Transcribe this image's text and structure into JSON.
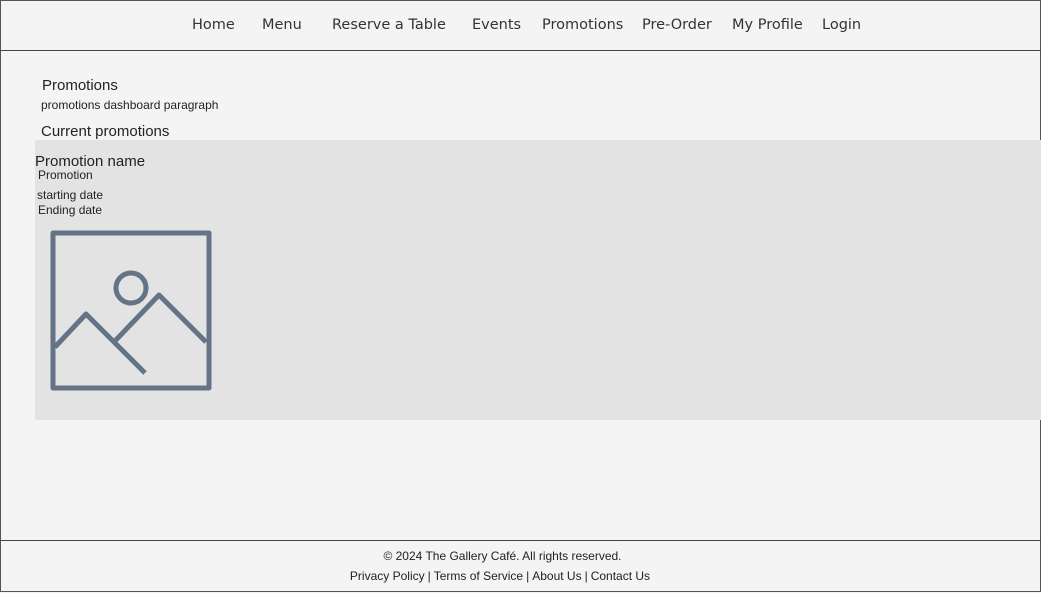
{
  "nav": {
    "items": [
      "Home",
      "Menu",
      "Reserve a Table",
      "Events",
      "Promotions",
      "Pre-Order",
      "My Profile",
      "Login"
    ]
  },
  "main": {
    "title": "Promotions",
    "description": "promotions dashboard paragraph",
    "section_title": "Current promotions",
    "promotion": {
      "name": "Promotion name",
      "detail": "Promotion",
      "start": "starting date",
      "end": "Ending date",
      "image_icon": "image-placeholder-icon"
    }
  },
  "footer": {
    "copyright": "© 2024 The Gallery Café. All rights reserved.",
    "links": [
      "Privacy Policy",
      "Terms of Service",
      "About Us",
      "Contact Us"
    ],
    "separator": "|"
  },
  "colors": {
    "background": "#f4f4f4",
    "card": "#e3e3e3",
    "icon": "#647386"
  }
}
